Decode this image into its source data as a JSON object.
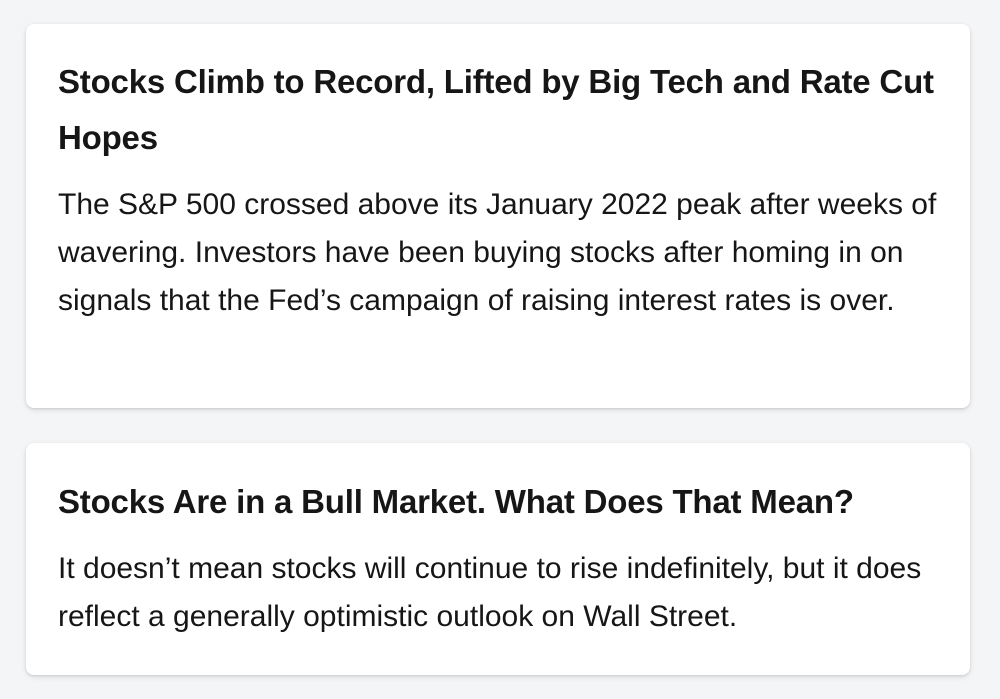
{
  "articles": [
    {
      "headline": "Stocks Climb to Record, Lifted by Big Tech and Rate Cut Hopes",
      "summary": "The S&P 500 crossed above its January 2022 peak after weeks of wavering. Investors have been buying stocks after homing in on signals that the Fed’s campaign of raising interest rates is over."
    },
    {
      "headline": "Stocks Are in a Bull Market. What Does That Mean?",
      "summary": "It doesn’t mean stocks will continue to rise indefinitely, but it does reflect a generally optimistic outlook on Wall Street."
    }
  ]
}
